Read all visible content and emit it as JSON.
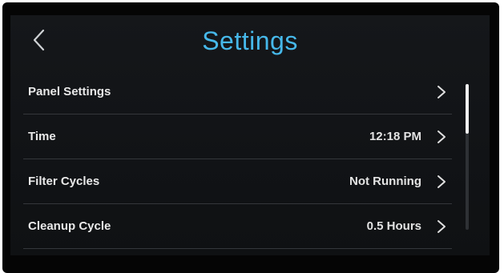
{
  "header": {
    "title": "Settings",
    "back_icon": "chevron-left-icon"
  },
  "list": {
    "items": [
      {
        "label": "Panel Settings",
        "value": ""
      },
      {
        "label": "Time",
        "value": "12:18 PM"
      },
      {
        "label": "Filter Cycles",
        "value": "Not Running"
      },
      {
        "label": "Cleanup Cycle",
        "value": "0.5 Hours"
      }
    ],
    "chevron_icon": "chevron-right-icon"
  },
  "colors": {
    "accent": "#46b8ea",
    "background": "#131518",
    "text": "#e9e9e9",
    "divider": "#34373b"
  }
}
